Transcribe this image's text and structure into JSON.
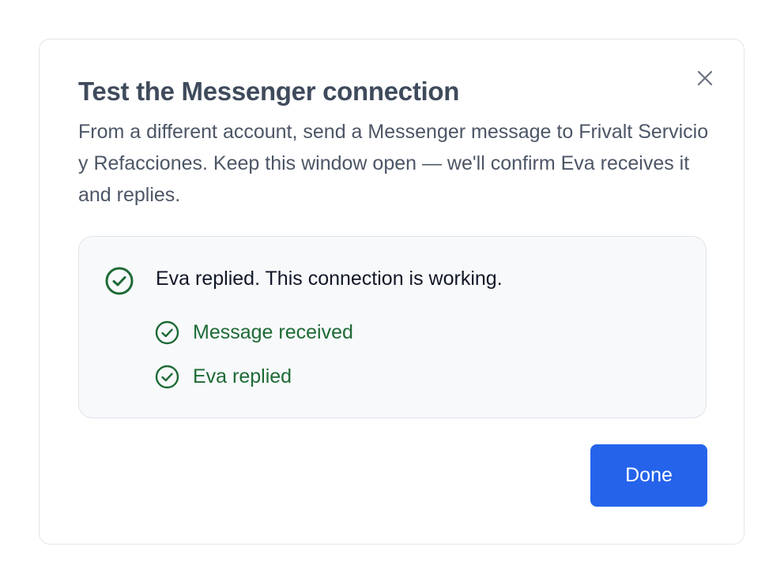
{
  "dialog": {
    "title": "Test the Messenger connection",
    "description": "From a different account, send a Messenger message to Frivalt Servicio y Refacciones. Keep this window open — we'll confirm Eva receives it and replies.",
    "close_icon": "close-icon"
  },
  "status": {
    "message": "Eva replied. This connection is working.",
    "icon": "check-circle-icon",
    "checks": [
      {
        "label": "Message received",
        "icon": "check-circle-icon"
      },
      {
        "label": "Eva replied",
        "icon": "check-circle-icon"
      }
    ]
  },
  "actions": {
    "done_label": "Done"
  },
  "colors": {
    "accent": "#2563eb",
    "success": "#1d6a35",
    "title": "#3f4b5c",
    "border": "#e2e5ea",
    "panel_bg": "#f7f9fb"
  }
}
